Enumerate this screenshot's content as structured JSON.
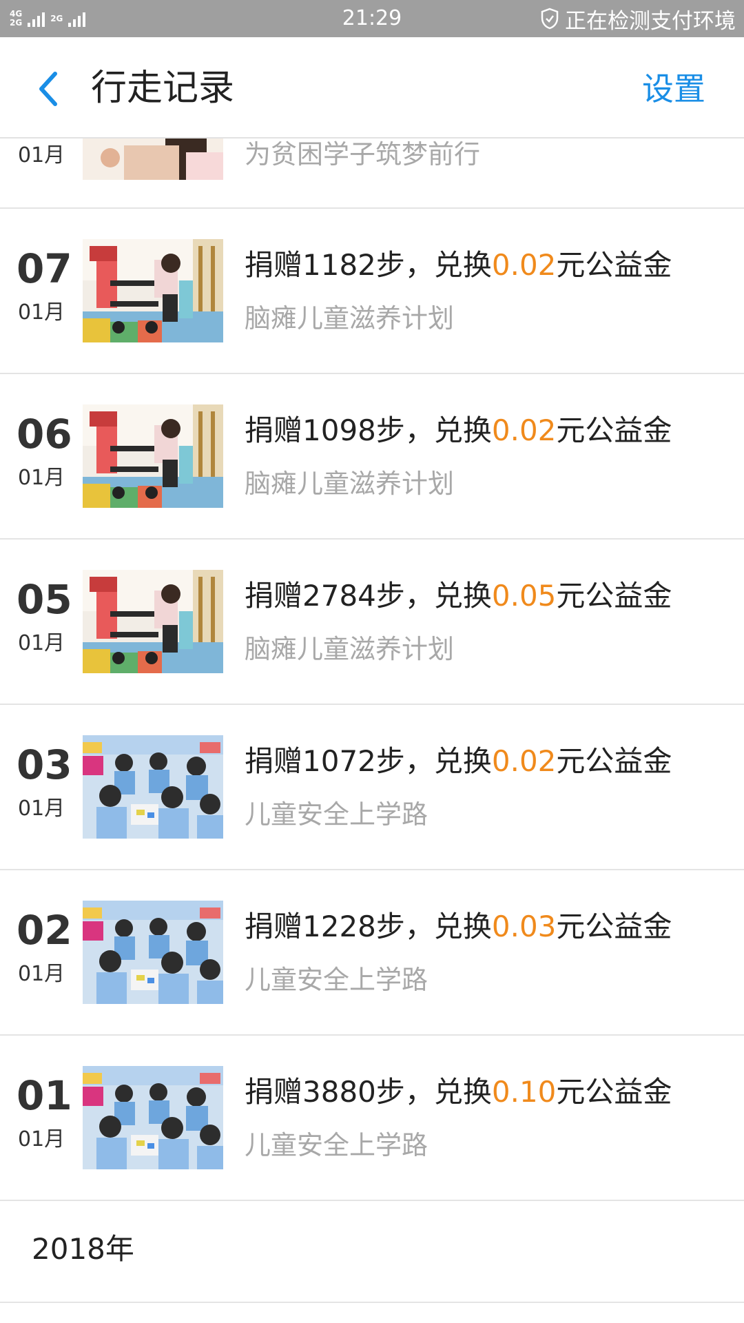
{
  "status_bar": {
    "network_top": "4G",
    "network_bottom": "2G",
    "network_second": "2G",
    "time": "21:29",
    "security_text": "正在检测支付环境"
  },
  "header": {
    "title": "行走记录",
    "settings": "设置"
  },
  "partial_record": {
    "month": "01月",
    "project": "为贫困学子筑梦前行"
  },
  "records": [
    {
      "day": "07",
      "month": "01月",
      "prefix": "捐赠1182步，兑换",
      "amount": "0.02",
      "suffix": "元公益金",
      "project": "脑瘫儿童滋养计划",
      "image": "therapy-photo"
    },
    {
      "day": "06",
      "month": "01月",
      "prefix": "捐赠1098步，兑换",
      "amount": "0.02",
      "suffix": "元公益金",
      "project": "脑瘫儿童滋养计划",
      "image": "therapy-photo"
    },
    {
      "day": "05",
      "month": "01月",
      "prefix": "捐赠2784步，兑换",
      "amount": "0.05",
      "suffix": "元公益金",
      "project": "脑瘫儿童滋养计划",
      "image": "therapy-photo"
    },
    {
      "day": "03",
      "month": "01月",
      "prefix": "捐赠1072步，兑换",
      "amount": "0.02",
      "suffix": "元公益金",
      "project": "儿童安全上学路",
      "image": "classroom-photo"
    },
    {
      "day": "02",
      "month": "01月",
      "prefix": "捐赠1228步，兑换",
      "amount": "0.03",
      "suffix": "元公益金",
      "project": "儿童安全上学路",
      "image": "classroom-photo"
    },
    {
      "day": "01",
      "month": "01月",
      "prefix": "捐赠3880步，兑换",
      "amount": "0.10",
      "suffix": "元公益金",
      "project": "儿童安全上学路",
      "image": "classroom-photo"
    }
  ],
  "year_section": "2018年",
  "colors": {
    "accent_blue": "#1a8ee6",
    "amount_orange": "#f08a1c",
    "status_bar_bg": "#9f9f9f"
  }
}
